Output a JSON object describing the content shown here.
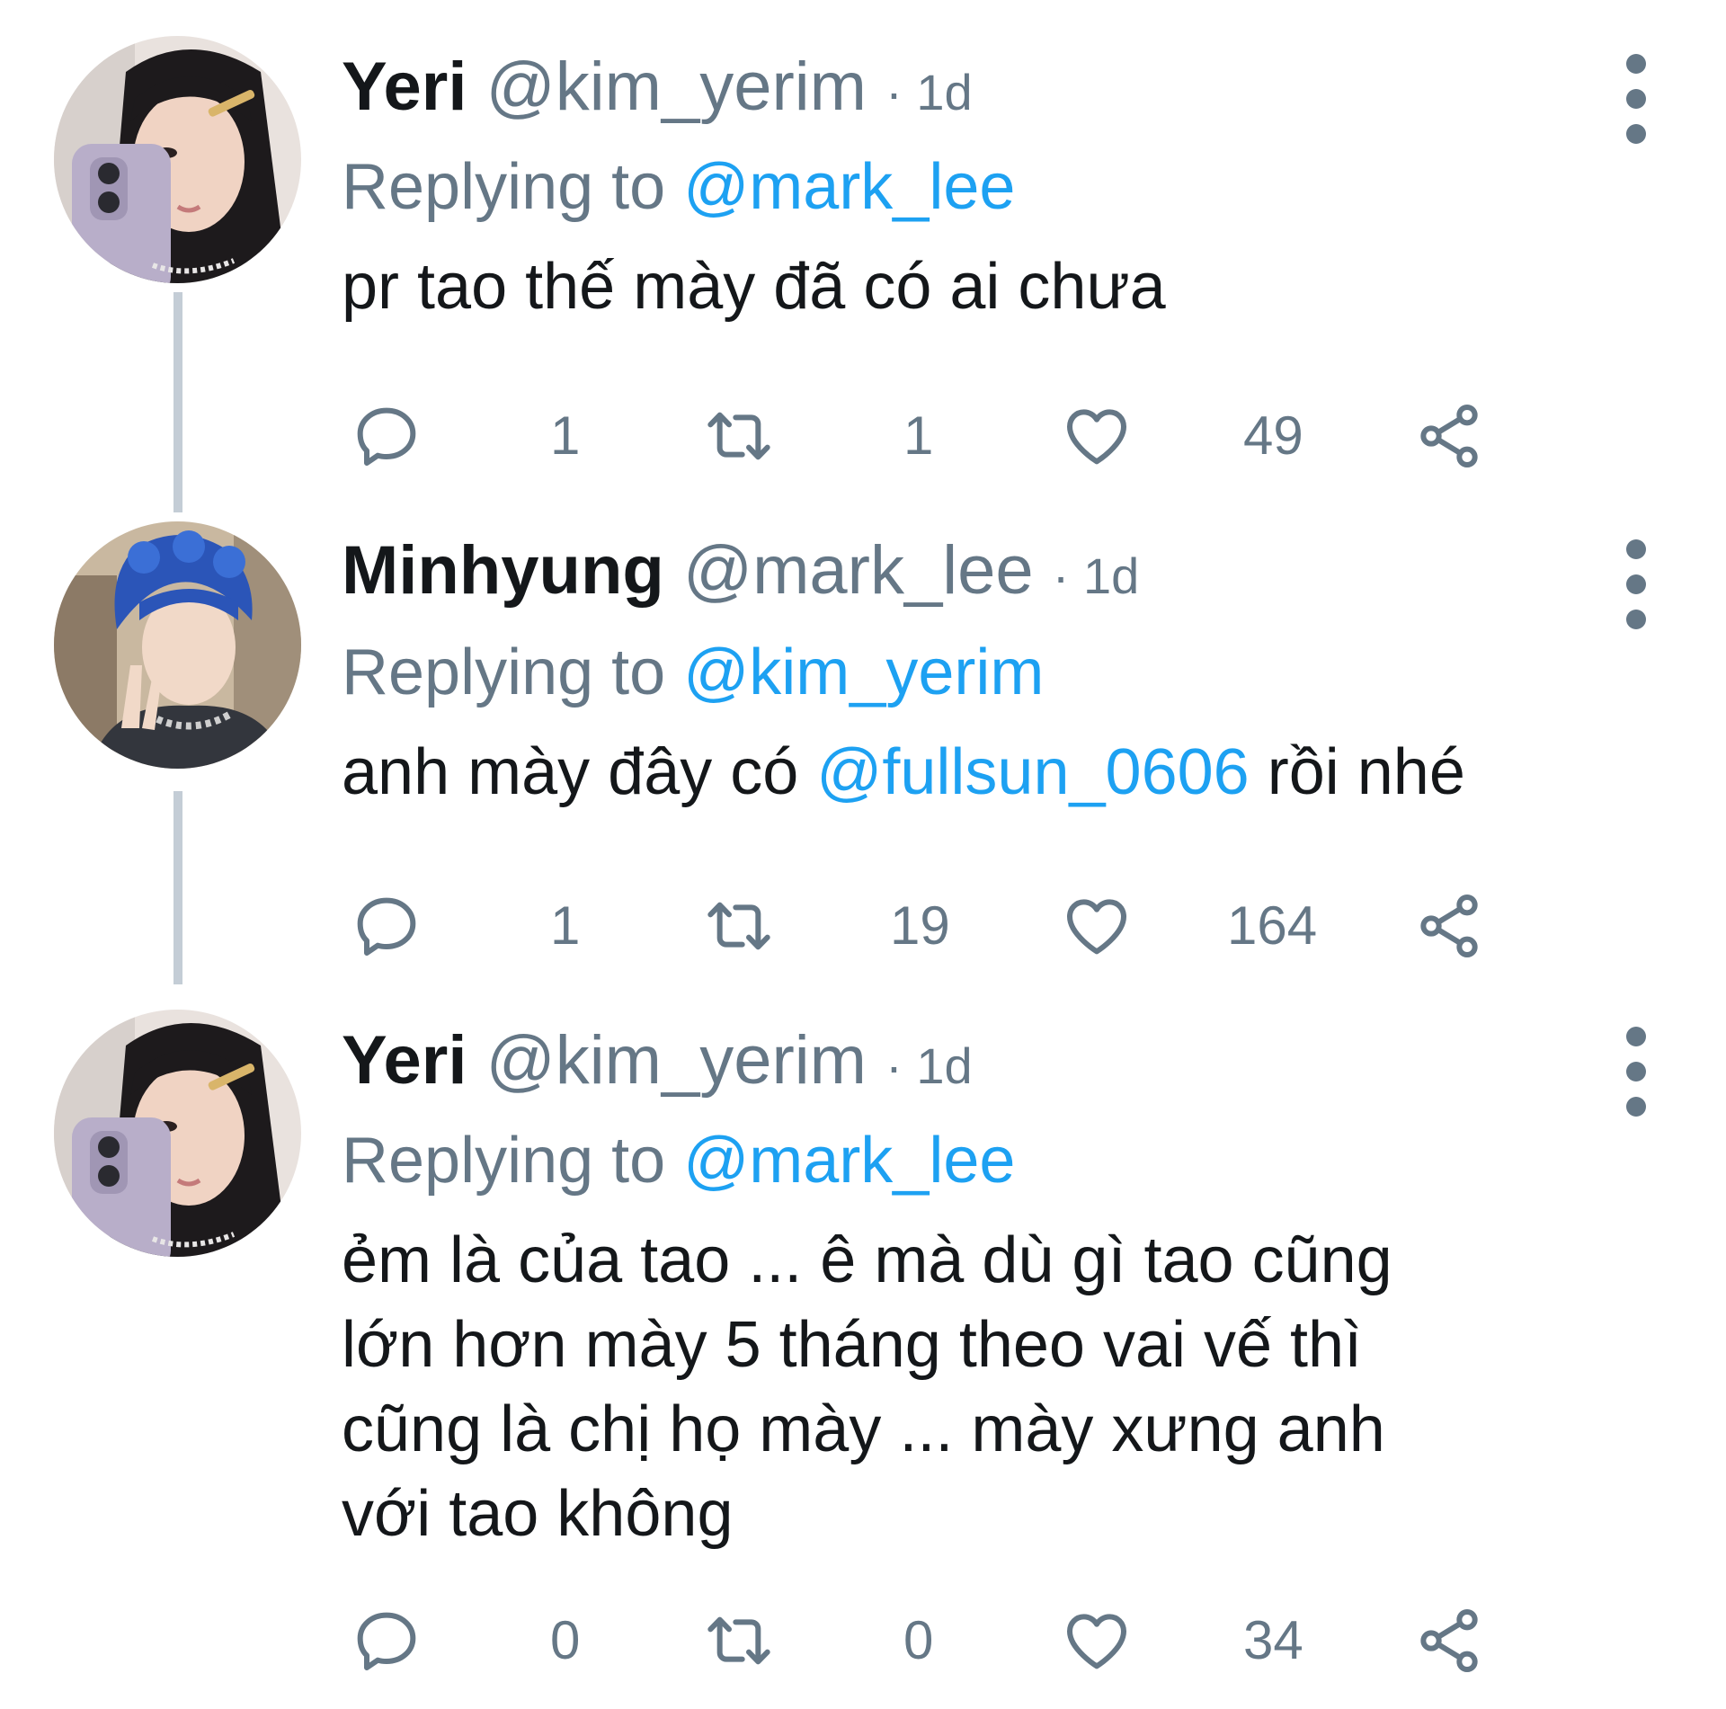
{
  "tweets": [
    {
      "name": "Yeri",
      "handle": "@kim_yerim",
      "time": "· 1d",
      "replying_prefix": "Replying to ",
      "replying_to": "@mark_lee",
      "text": "pr tao thế mày đã có ai chưa",
      "replies": "1",
      "retweets": "1",
      "likes": "49"
    },
    {
      "name": "Minhyung",
      "handle": "@mark_lee",
      "time": "· 1d",
      "replying_prefix": "Replying to ",
      "replying_to": "@kim_yerim",
      "text_before": "anh mày đây có ",
      "text_mention": "@fullsun_0606",
      "text_after": " rồi nhé",
      "replies": "1",
      "retweets": "19",
      "likes": "164"
    },
    {
      "name": "Yeri",
      "handle": "@kim_yerim",
      "time": "· 1d",
      "replying_prefix": "Replying to ",
      "replying_to": "@mark_lee",
      "lines": [
        "ẻm là của tao ... ê mà dù gì tao cũng",
        "lớn hơn mày 5 tháng theo vai vế thì",
        "cũng là chị họ mày ... mày xưng anh",
        "với tao không"
      ],
      "replies": "0",
      "retweets": "0",
      "likes": "34"
    }
  ],
  "colors": {
    "text": "#14171a",
    "secondary": "#657786",
    "link": "#1da1f2",
    "thread_line": "#c4cdd6"
  },
  "icons": [
    "reply-icon",
    "retweet-icon",
    "like-icon",
    "share-icon",
    "more-options-icon"
  ]
}
